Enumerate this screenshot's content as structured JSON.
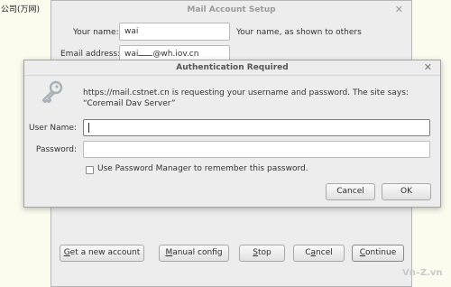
{
  "background": {
    "label": "公司(万网)"
  },
  "mail_setup": {
    "title": "Mail Account Setup",
    "name_label": "Your name:",
    "name_value": "wai",
    "name_hint": "Your name, as shown to others",
    "email_label": "Email address:",
    "email_value_prefix": "wai",
    "email_value_suffix": "@wh.iov.cn",
    "buttons": {
      "get_account": {
        "acc": "G",
        "rest": "et a new account"
      },
      "manual_config": {
        "acc": "M",
        "rest": "anual config"
      },
      "stop": {
        "acc": "S",
        "rest": "top"
      },
      "cancel": {
        "pre": "C",
        "acc": "a",
        "rest": "ncel"
      },
      "continue": {
        "acc": "C",
        "rest": "ontinue"
      }
    }
  },
  "auth_dialog": {
    "title": "Authentication Required",
    "message": "https://mail.cstnet.cn is requesting your username and password. The site says: “Coremail Dav Server”",
    "username_label": "User Name:",
    "username_value": "",
    "password_label": "Password:",
    "password_value": "",
    "remember_label": "Use Password Manager to remember this password.",
    "remember_checked": false,
    "cancel_label": "Cancel",
    "ok_label": "OK"
  },
  "watermark": "Vn–Z.vn",
  "icons": {
    "dialog_icon": "key-icon",
    "close": "close-icon"
  }
}
